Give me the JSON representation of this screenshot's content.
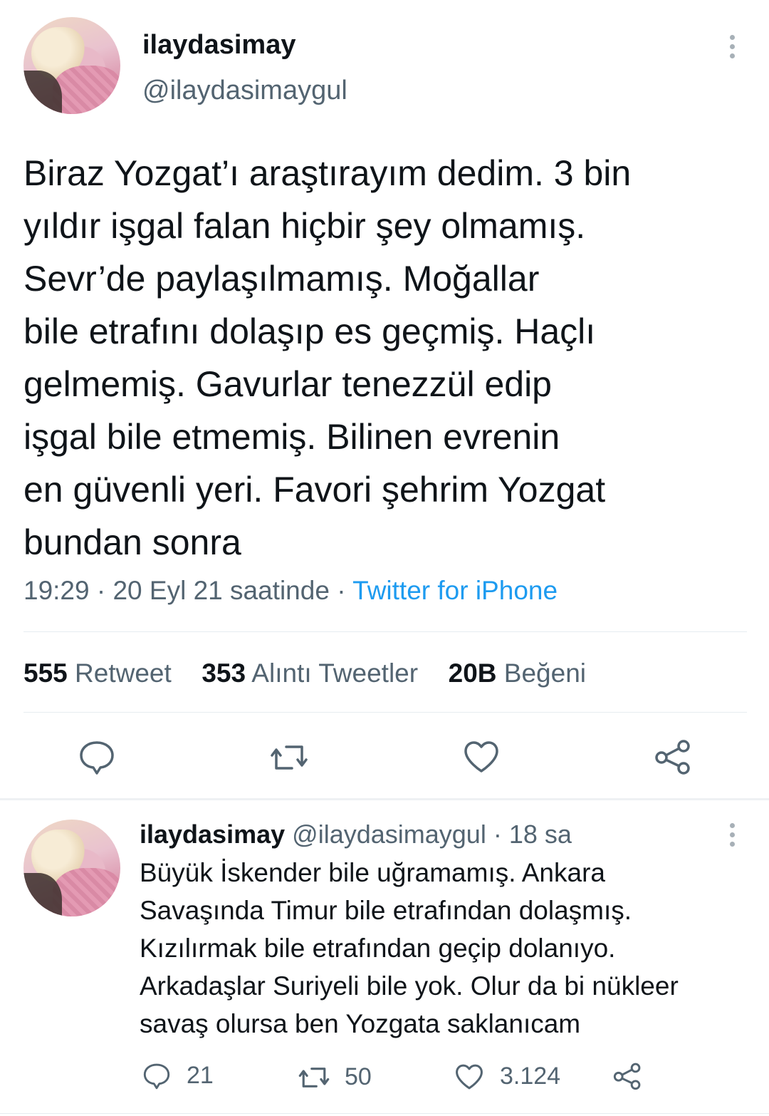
{
  "main_tweet": {
    "display_name": "ilaydasimay",
    "handle": "@ilaydasimaygul",
    "text_lines": [
      "Biraz Yozgat’ı araştırayım dedim. 3 bin",
      "yıldır işgal falan hiçbir şey olmamış.",
      "Sevr’de paylaşılmamış. Moğallar",
      "bile etrafını dolaşıp es geçmiş. Haçlı",
      "gelmemiş. Gavurlar tenezzül edip",
      "işgal bile etmemiş. Bilinen evrenin",
      "en güvenli yeri. Favori şehrim Yozgat",
      "bundan sonra"
    ],
    "timestamp": "19:29 · 20 Eyl 21 saatinde ·",
    "source": "Twitter for iPhone",
    "stats": {
      "retweets_count": "555",
      "retweets_label": "Retweet",
      "quotes_count": "353",
      "quotes_label": "Alıntı Tweetler",
      "likes_count": "20B",
      "likes_label": "Beğeni"
    },
    "actions": [
      "reply-icon",
      "retweet-icon",
      "like-icon",
      "share-icon"
    ]
  },
  "reply_tweet": {
    "display_name": "ilaydasimay",
    "handle": "@ilaydasimaygul",
    "time_ago": "· 18 sa",
    "text_lines": [
      "Büyük İskender bile uğramamış. Ankara",
      "Savaşında Timur bile etrafından dolaşmış.",
      "Kızılırmak bile etrafından geçip dolanıyo.",
      "Arkadaşlar Suriyeli bile yok. Olur da bi nükleer",
      "savaş olursa ben Yozgata saklanıcam"
    ],
    "reply_count": "21",
    "retweet_count": "50",
    "like_count": "3.124"
  },
  "colors": {
    "text": "#0f1419",
    "muted": "#536471",
    "link": "#1d9bf0",
    "divider": "#e6ecf0"
  }
}
